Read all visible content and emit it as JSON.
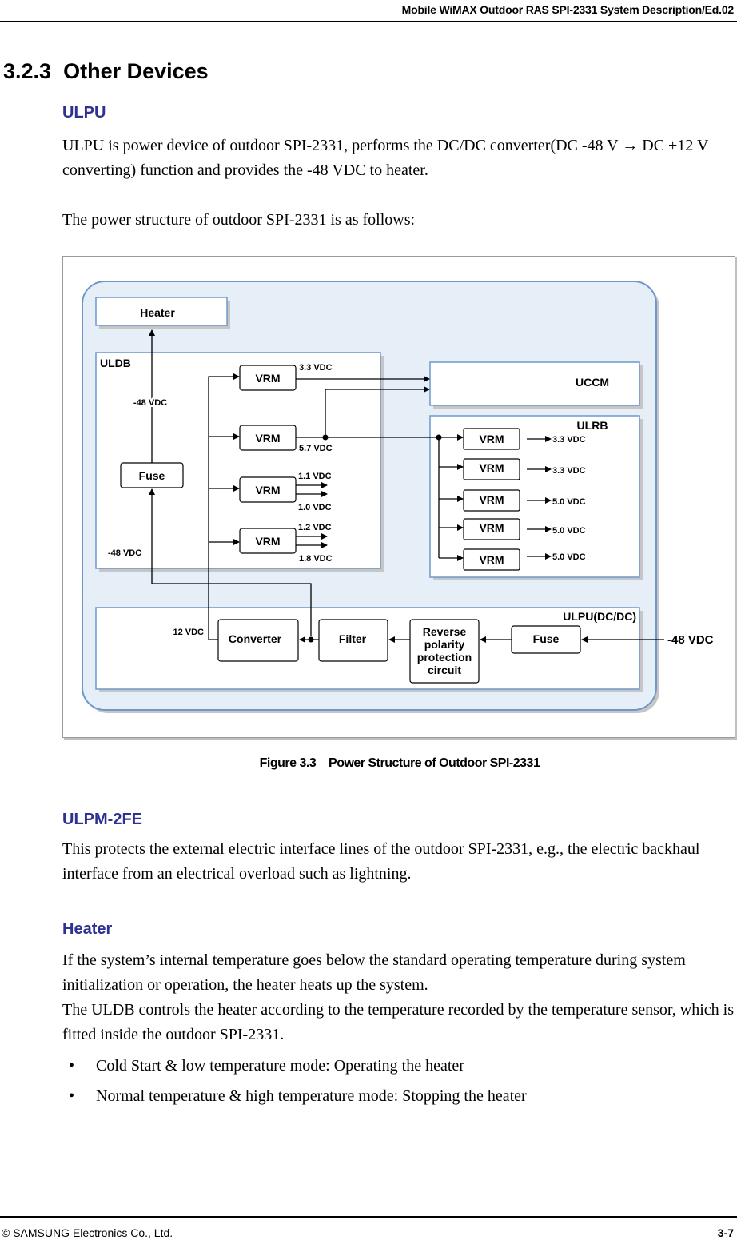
{
  "header": {
    "title": "Mobile WiMAX Outdoor RAS SPI-2331 System Description/Ed.02"
  },
  "section": {
    "number": "3.2.3",
    "title": "Other Devices"
  },
  "ulpu": {
    "heading": "ULPU",
    "paragraph1": "ULPU is power device of outdoor SPI-2331, performs the DC/DC converter(DC -48 V → DC +12 V converting) function and provides the -48 VDC to heater.",
    "paragraph2": "The power structure of outdoor SPI-2331 is as follows:"
  },
  "diagram": {
    "heater": "Heater",
    "uldb": {
      "label": "ULDB",
      "fuse": "Fuse",
      "heater_feed": "-48 VDC",
      "input_feed": "-48 VDC",
      "vrms": [
        {
          "label": "VRM",
          "outputs": [
            "3.3 VDC"
          ]
        },
        {
          "label": "VRM",
          "outputs": [
            "5.7 VDC"
          ]
        },
        {
          "label": "VRM",
          "outputs": [
            "1.1 VDC",
            "1.0 VDC"
          ]
        },
        {
          "label": "VRM",
          "outputs": [
            "1.2 VDC",
            "1.8 VDC"
          ]
        }
      ]
    },
    "uccm": {
      "label": "UCCM"
    },
    "ulrb": {
      "label": "ULRB",
      "vrms": [
        {
          "label": "VRM",
          "output": "3.3 VDC"
        },
        {
          "label": "VRM",
          "output": "3.3 VDC"
        },
        {
          "label": "VRM",
          "output": "5.0 VDC"
        },
        {
          "label": "VRM",
          "output": "5.0 VDC"
        },
        {
          "label": "VRM",
          "output": "5.0 VDC"
        }
      ]
    },
    "ulpu": {
      "label": "ULPU(DC/DC)",
      "converter": "Converter",
      "filter": "Filter",
      "reverse_protection": [
        "Reverse",
        "polarity",
        "protection",
        "circuit"
      ],
      "fuse": "Fuse",
      "output": "12 VDC",
      "input": "-48 VDC"
    },
    "colors": {
      "outer_fill": "#e6eef8",
      "box_border": "#6d98cc",
      "shadow": "#c0c0c0"
    }
  },
  "figure": {
    "caption": "Figure 3.3    Power Structure of Outdoor SPI-2331"
  },
  "ulpm": {
    "heading": "ULPM-2FE",
    "paragraph": "This protects the external electric interface lines of the outdoor SPI-2331, e.g., the electric backhaul interface from an electrical overload such as lightning."
  },
  "heater_section": {
    "heading": "Heater",
    "paragraph1": "If the system’s internal temperature goes below the standard operating temperature during system initialization or operation, the heater heats up the system.",
    "paragraph2": "The ULDB controls the heater according to the temperature recorded by the temperature sensor, which is fitted inside the outdoor SPI-2331.",
    "bullets": [
      "Cold Start & low temperature mode: Operating the heater",
      "Normal temperature & high temperature mode: Stopping the heater"
    ]
  },
  "footer": {
    "copyright": "© SAMSUNG Electronics Co., Ltd.",
    "page": "3-7"
  },
  "accent_color": "#2e3192"
}
